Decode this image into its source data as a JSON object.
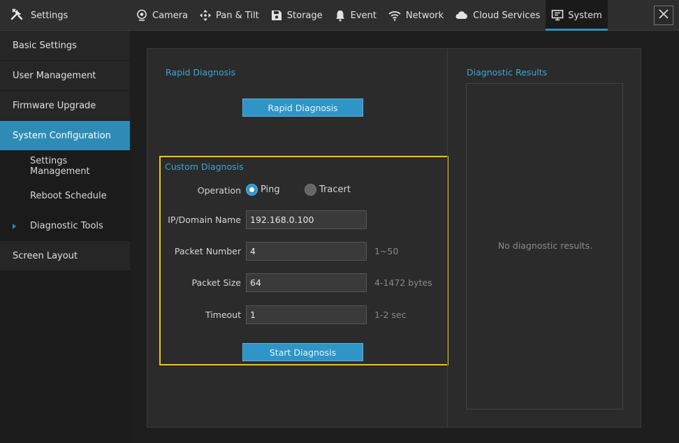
{
  "app": {
    "title": "Settings"
  },
  "tabs": [
    {
      "label": "Camera",
      "icon": "camera-icon"
    },
    {
      "label": "Pan & Tilt",
      "icon": "pan-tilt-icon"
    },
    {
      "label": "Storage",
      "icon": "storage-icon"
    },
    {
      "label": "Event",
      "icon": "bell-icon"
    },
    {
      "label": "Network",
      "icon": "wifi-icon"
    },
    {
      "label": "Cloud Services",
      "icon": "cloud-icon"
    },
    {
      "label": "System",
      "icon": "monitor-icon",
      "active": true
    }
  ],
  "sidebar": {
    "items": [
      {
        "label": "Basic Settings"
      },
      {
        "label": "User Management"
      },
      {
        "label": "Firmware Upgrade"
      },
      {
        "label": "System Configuration",
        "active": true
      },
      {
        "label": "Settings Management"
      },
      {
        "label": "Reboot Schedule"
      },
      {
        "label": "Diagnostic Tools",
        "current": true
      },
      {
        "label": "Screen Layout"
      }
    ]
  },
  "rapid": {
    "title": "Rapid Diagnosis",
    "button": "Rapid Diagnosis"
  },
  "custom": {
    "title": "Custom Diagnosis",
    "operation_label": "Operation",
    "options": {
      "ping": "Ping",
      "tracert": "Tracert",
      "selected": "Ping"
    },
    "ip_label": "IP/Domain Name",
    "ip_value": "192.168.0.100",
    "packet_number_label": "Packet Number",
    "packet_number_value": "4",
    "packet_number_hint": "1~50",
    "packet_size_label": "Packet Size",
    "packet_size_value": "64",
    "packet_size_hint": "4-1472 bytes",
    "timeout_label": "Timeout",
    "timeout_value": "1",
    "timeout_hint": "1-2 sec",
    "button": "Start Diagnosis"
  },
  "results": {
    "title": "Diagnostic Results",
    "empty": "No diagnostic results."
  },
  "colors": {
    "accent": "#2f95c6",
    "highlight": "#f1c40f"
  }
}
